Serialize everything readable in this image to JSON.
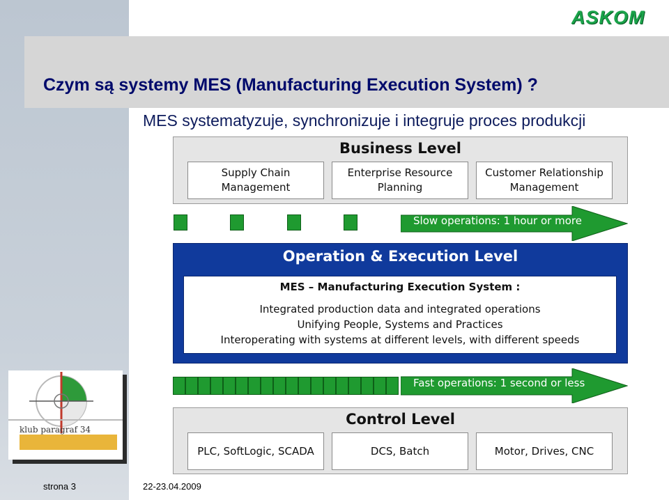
{
  "logo": {
    "brand": "ASKOM"
  },
  "header": {
    "title": "Czym są systemy MES (Manufacturing Execution System) ?",
    "subtitle": "MES systematyzuje, synchronizuje i integruje proces produkcji"
  },
  "business_level": {
    "title": "Business Level",
    "boxes": [
      "Supply Chain\nManagement",
      "Enterprise Resource\nPlanning",
      "Customer Relationship\nManagement"
    ]
  },
  "slow_arrow": {
    "label": "Slow operations: 1 hour or more"
  },
  "operation_level": {
    "title": "Operation & Execution Level",
    "mes_heading": "MES – Manufacturing Execution System :",
    "lines": [
      "Integrated production data and integrated operations",
      "Unifying People, Systems and Practices",
      "Interoperating with systems at different levels, with different speeds"
    ]
  },
  "fast_arrow": {
    "label": "Fast operations: 1 second or less"
  },
  "control_level": {
    "title": "Control Level",
    "boxes": [
      "PLC, SoftLogic, SCADA",
      "DCS, Batch",
      "Motor, Drives, CNC"
    ]
  },
  "club_logo": {
    "text": "klub paragraf 34"
  },
  "footer": {
    "page": "strona 3",
    "date": "22-23.04.2009"
  },
  "colors": {
    "title": "#000a6b",
    "operation_bg": "#103a9c",
    "arrow_green": "#1f9a30",
    "level_bg": "#e5e5e5"
  }
}
